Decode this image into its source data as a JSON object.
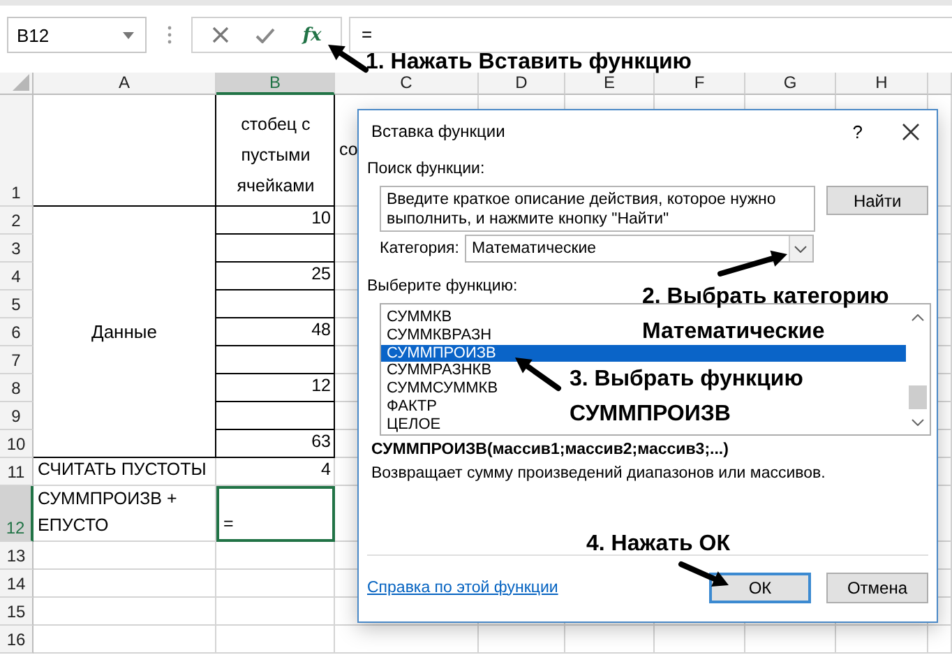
{
  "formula_bar": {
    "name_box": "B12",
    "insert_function": "fx",
    "formula": "="
  },
  "columns": [
    {
      "label": "A",
      "selected": false
    },
    {
      "label": "B",
      "selected": true
    },
    {
      "label": "C",
      "selected": false
    },
    {
      "label": "D",
      "selected": false
    },
    {
      "label": "E",
      "selected": false
    },
    {
      "label": "F",
      "selected": false
    },
    {
      "label": "G",
      "selected": false
    },
    {
      "label": "H",
      "selected": false
    }
  ],
  "rows": [
    {
      "number": "1",
      "selected": false,
      "b": "стобец с пустыми ячейками",
      "c": "со"
    },
    {
      "number": "2",
      "selected": false,
      "b": "10"
    },
    {
      "number": "3",
      "selected": false
    },
    {
      "number": "4",
      "selected": false,
      "b": "25"
    },
    {
      "number": "5",
      "selected": false
    },
    {
      "number": "6",
      "selected": false,
      "b": "48"
    },
    {
      "number": "7",
      "selected": false
    },
    {
      "number": "8",
      "selected": false,
      "b": "12"
    },
    {
      "number": "9",
      "selected": false
    },
    {
      "number": "10",
      "selected": false,
      "b": "63"
    },
    {
      "number": "11",
      "selected": false,
      "a": "СЧИТАТЬ ПУСТОТЫ",
      "b": "4"
    },
    {
      "number": "12",
      "selected": true,
      "a": "СУММПРОИЗВ + ЕПУСТО",
      "b": "="
    },
    {
      "number": "13",
      "selected": false
    },
    {
      "number": "14",
      "selected": false
    },
    {
      "number": "15",
      "selected": false
    },
    {
      "number": "16",
      "selected": false
    }
  ],
  "merged_cell": {
    "text": "Данные"
  },
  "dialog": {
    "title": "Вставка функции",
    "help": "?",
    "search_label": "Поиск функции:",
    "search_value": "Введите краткое описание действия, которое нужно выполнить, и нажмите кнопку \"Найти\"",
    "find_button": "Найти",
    "category_label": "Категория:",
    "category_value": "Математические",
    "list_label": "Выберите функцию:",
    "functions": [
      {
        "name": "СУММКВ",
        "selected": false
      },
      {
        "name": "СУММКВРАЗН",
        "selected": false
      },
      {
        "name": "СУММПРОИЗВ",
        "selected": true
      },
      {
        "name": "СУММРАЗНКВ",
        "selected": false
      },
      {
        "name": "СУММСУММКВ",
        "selected": false
      },
      {
        "name": "ФАКТР",
        "selected": false
      },
      {
        "name": "ЦЕЛОЕ",
        "selected": false
      }
    ],
    "signature": "СУММПРОИЗВ(массив1;массив2;массив3;...)",
    "description": "Возвращает сумму произведений диапазонов или массивов.",
    "help_link": "Справка по этой функции",
    "buttons": [
      {
        "label": "ОК",
        "default": true
      },
      {
        "label": "Отмена",
        "default": false
      }
    ]
  },
  "annotations": [
    {
      "lines": [
        "1. Нажать Вставить функцию"
      ]
    },
    {
      "lines": [
        "2. Выбрать категорию",
        "Математические"
      ]
    },
    {
      "lines": [
        "3. Выбрать функцию",
        "СУММПРОИЗВ"
      ]
    },
    {
      "lines": [
        "4. Нажать ОК"
      ]
    }
  ]
}
